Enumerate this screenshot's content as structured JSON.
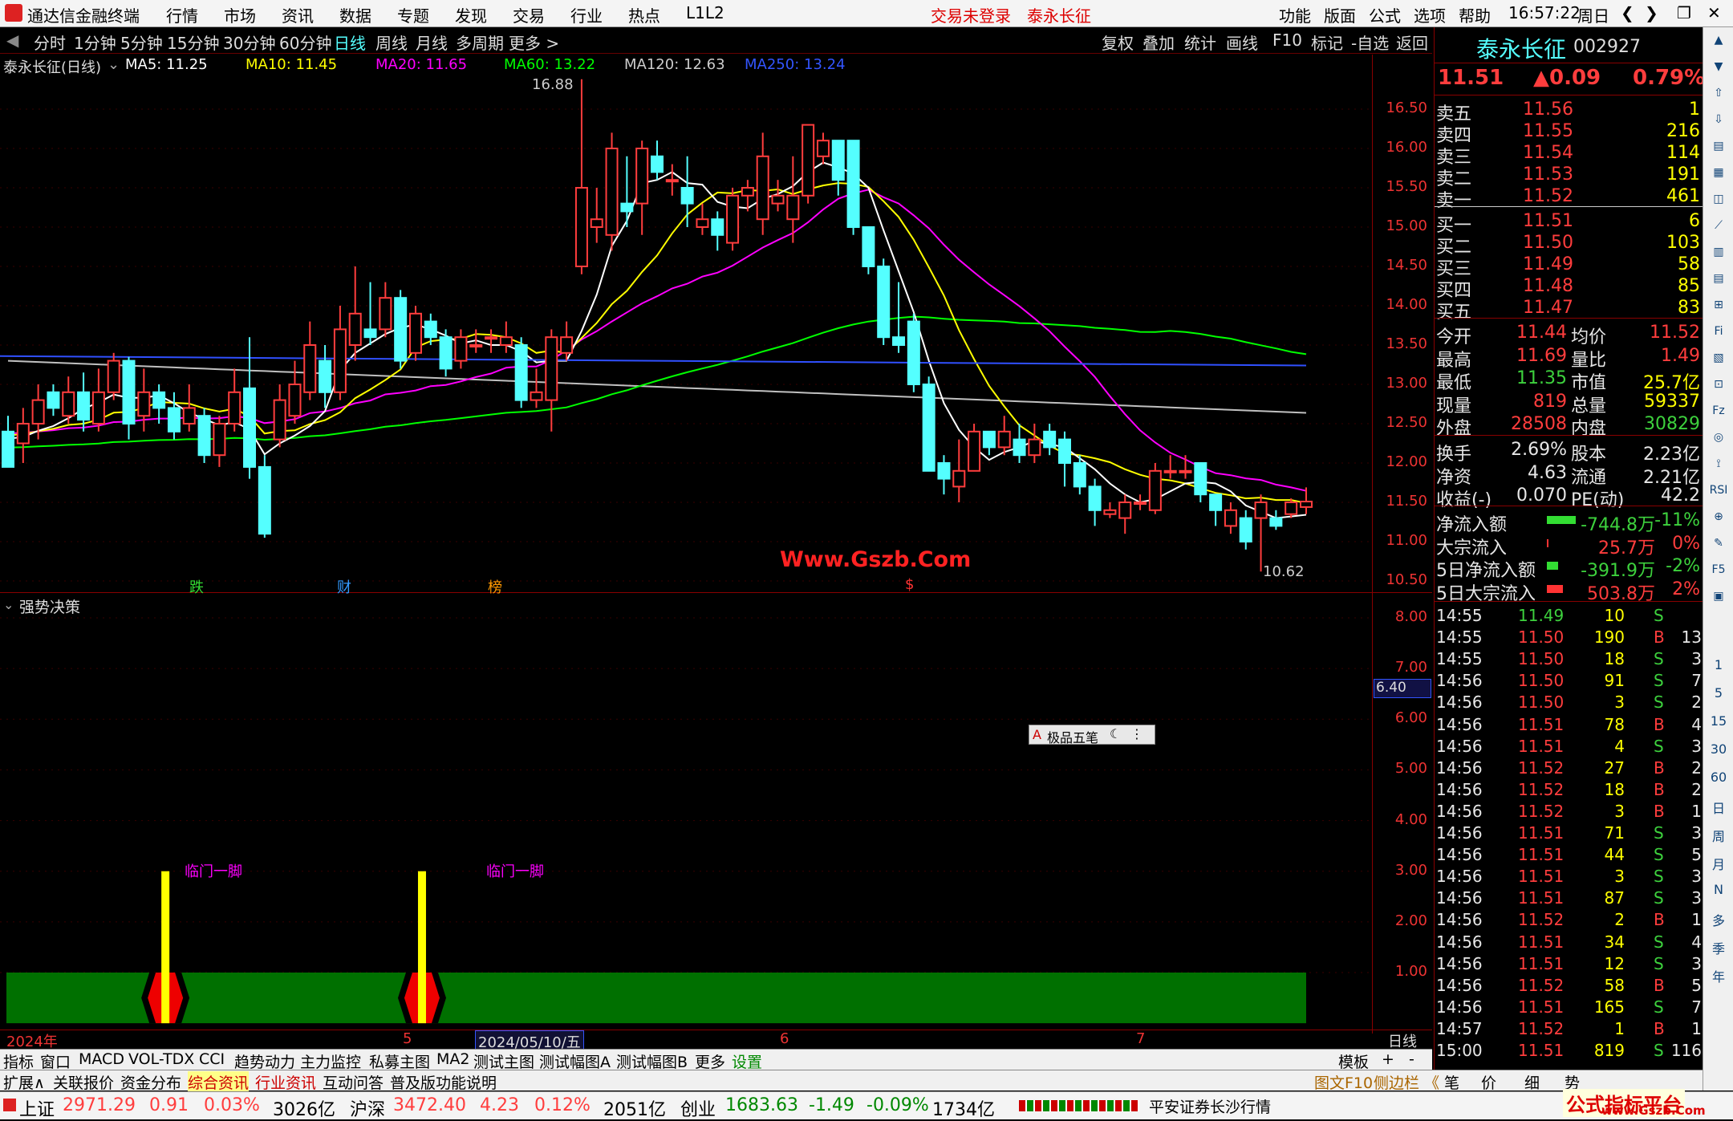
{
  "menubar": {
    "app_title": "通达信金融终端",
    "menus": [
      "行情",
      "市场",
      "资讯",
      "数据",
      "专题",
      "发现",
      "交易",
      "行业",
      "热点",
      "L1L2"
    ],
    "trade_status": "交易未登录",
    "stock_name": "泰永长征",
    "right_menus": [
      "功能",
      "版面",
      "公式",
      "选项",
      "帮助"
    ],
    "time": "16:57:22",
    "weekday": "周日"
  },
  "toolbar": {
    "periods": [
      "分时",
      "1分钟",
      "5分钟",
      "15分钟",
      "30分钟",
      "60分钟",
      "日线",
      "周线",
      "月线",
      "多周期",
      "更多 >"
    ],
    "active": "日线",
    "right": [
      "复权",
      "叠加",
      "统计",
      "画线",
      "F10",
      "标记",
      "-自选",
      "返回"
    ]
  },
  "chart_header": {
    "title": "泰永长征(日线)",
    "ma5": "MA5: 11.25",
    "ma10": "MA10: 11.45",
    "ma20": "MA20: 11.65",
    "ma60": "MA60: 13.22",
    "ma120": "MA120: 12.63",
    "ma250": "MA250: 13.24"
  },
  "colors": {
    "up": "#ff3d3d",
    "down": "#54ffff",
    "ma5": "#ffffff",
    "ma10": "#ffff00",
    "ma20": "#ff00ff",
    "ma60": "#00ff00",
    "ma120": "#c0c0c0",
    "ma250": "#3050ff"
  },
  "price_axis": [
    "16.50",
    "16.00",
    "15.50",
    "15.00",
    "14.50",
    "14.00",
    "13.50",
    "13.00",
    "12.50",
    "12.00",
    "11.50",
    "11.00",
    "10.50"
  ],
  "annotations": {
    "high": "16.88",
    "low": "10.62",
    "watermark": "Www.Gszb.Com",
    "marks": [
      "跌",
      "财",
      "榜",
      "$"
    ]
  },
  "indicator": {
    "title": "强势决策",
    "axis": [
      "8.00",
      "7.00",
      "6.00",
      "5.00",
      "4.00",
      "3.00",
      "2.00",
      "1.00"
    ],
    "current": "6.40",
    "signal_label": "临门一脚",
    "toolbox_label": "极品五笔",
    "toolbox_icon": "A"
  },
  "date_axis": {
    "start": "2024年",
    "m5": "5",
    "cursor": "2024/05/10/五",
    "m6": "6",
    "m7": "7",
    "period": "日线"
  },
  "quote": {
    "name": "泰永长征",
    "code": "002927",
    "price": "11.51",
    "change": "▲0.09",
    "pct": "0.79%",
    "asks": [
      {
        "label": "卖五",
        "price": "11.56",
        "vol": "1"
      },
      {
        "label": "卖四",
        "price": "11.55",
        "vol": "216"
      },
      {
        "label": "卖三",
        "price": "11.54",
        "vol": "114"
      },
      {
        "label": "卖二",
        "price": "11.53",
        "vol": "191"
      },
      {
        "label": "卖一",
        "price": "11.52",
        "vol": "461"
      }
    ],
    "bids": [
      {
        "label": "买一",
        "price": "11.51",
        "vol": "6"
      },
      {
        "label": "买二",
        "price": "11.50",
        "vol": "103"
      },
      {
        "label": "买三",
        "price": "11.49",
        "vol": "58"
      },
      {
        "label": "买四",
        "price": "11.48",
        "vol": "85"
      },
      {
        "label": "买五",
        "price": "11.47",
        "vol": "83"
      }
    ],
    "stats": [
      [
        "今开",
        "11.44",
        "均价",
        "11.52"
      ],
      [
        "最高",
        "11.69",
        "量比",
        "1.49"
      ],
      [
        "最低",
        "11.35",
        "市值",
        "25.7亿"
      ],
      [
        "现量",
        "819",
        "总量",
        "59337"
      ],
      [
        "外盘",
        "28508",
        "内盘",
        "30829"
      ]
    ],
    "stats2": [
      [
        "换手",
        "2.69%",
        "股本",
        "2.23亿"
      ],
      [
        "净资",
        "4.63",
        "流通",
        "2.21亿"
      ],
      [
        "收益(-)",
        "0.070",
        "PE(动)",
        "42.2"
      ]
    ],
    "flows": [
      [
        "净流入额",
        "-744.8万",
        "-11%"
      ],
      [
        "大宗流入",
        "25.7万",
        "0%"
      ],
      [
        "5日净流入额",
        "-391.9万",
        "-2%"
      ],
      [
        "5日大宗流入",
        "503.8万",
        "2%"
      ]
    ],
    "ticks": [
      [
        "14:55",
        "11.49",
        "10",
        "S",
        ""
      ],
      [
        "14:55",
        "11.50",
        "190",
        "B",
        "13"
      ],
      [
        "14:55",
        "11.50",
        "18",
        "S",
        "3"
      ],
      [
        "14:56",
        "11.50",
        "91",
        "S",
        "7"
      ],
      [
        "14:56",
        "11.50",
        "3",
        "S",
        "2"
      ],
      [
        "14:56",
        "11.51",
        "78",
        "B",
        "4"
      ],
      [
        "14:56",
        "11.51",
        "4",
        "S",
        "3"
      ],
      [
        "14:56",
        "11.52",
        "27",
        "B",
        "2"
      ],
      [
        "14:56",
        "11.52",
        "18",
        "B",
        "2"
      ],
      [
        "14:56",
        "11.52",
        "3",
        "B",
        "1"
      ],
      [
        "14:56",
        "11.51",
        "71",
        "S",
        "3"
      ],
      [
        "14:56",
        "11.51",
        "44",
        "S",
        "5"
      ],
      [
        "14:56",
        "11.51",
        "3",
        "S",
        "3"
      ],
      [
        "14:56",
        "11.51",
        "87",
        "S",
        "3"
      ],
      [
        "14:56",
        "11.52",
        "2",
        "B",
        "1"
      ],
      [
        "14:56",
        "11.51",
        "34",
        "S",
        "4"
      ],
      [
        "14:56",
        "11.51",
        "12",
        "S",
        "3"
      ],
      [
        "14:56",
        "11.52",
        "58",
        "B",
        "5"
      ],
      [
        "14:56",
        "11.51",
        "165",
        "S",
        "7"
      ],
      [
        "14:57",
        "11.52",
        "1",
        "B",
        "1"
      ],
      [
        "15:00",
        "11.51",
        "819",
        "S",
        "116"
      ]
    ]
  },
  "rightbar": [
    "1",
    "5",
    "15",
    "30",
    "60",
    "日",
    "周",
    "月",
    "N",
    "多",
    "季",
    "年"
  ],
  "tabs1": [
    "指标",
    "窗口",
    "MACD",
    "VOL-TDX",
    "CCI",
    "趋势动力",
    "主力监控",
    "私募主图",
    "MA2",
    "测试主图",
    "测试幅图A",
    "测试幅图B",
    "更多",
    "设置",
    "模板",
    "+",
    "-"
  ],
  "tabs2": [
    "扩展∧",
    "关联报价",
    "资金分布",
    "综合资讯",
    "行业资讯",
    "互动问答",
    "普及版功能说明",
    "图文F10",
    "侧边栏 《",
    "笔",
    "价",
    "细",
    "势"
  ],
  "status": {
    "sh_label": "上证",
    "sh": "2971.29",
    "sh_chg": "0.91",
    "sh_pct": "0.03%",
    "sh_amt": "3026亿",
    "hs_label": "沪深",
    "hs": "3472.40",
    "hs_chg": "4.23",
    "hs_pct": "0.12%",
    "hs_amt": "2051亿",
    "cy_label": "创业",
    "cy": "1683.63",
    "cy_chg": "-1.49",
    "cy_pct": "-0.09%",
    "cy_amt": "1734亿",
    "broker": "平安证券长沙行情",
    "brand": "公式指标平台",
    "brand_url": "www.Gszb.Com"
  },
  "candles": [
    [
      12.4,
      11.95,
      12.6,
      11.95
    ],
    [
      12.25,
      12.5,
      12.7,
      12.0
    ],
    [
      12.5,
      12.8,
      13.0,
      12.3
    ],
    [
      12.9,
      12.7,
      13.0,
      12.6
    ],
    [
      12.6,
      12.9,
      13.1,
      12.5
    ],
    [
      12.9,
      12.55,
      13.15,
      12.4
    ],
    [
      12.5,
      12.9,
      13.2,
      12.4
    ],
    [
      12.9,
      13.3,
      13.4,
      12.8
    ],
    [
      13.3,
      12.5,
      13.35,
      12.3
    ],
    [
      12.6,
      12.9,
      13.2,
      12.4
    ],
    [
      12.9,
      12.7,
      13.0,
      12.5
    ],
    [
      12.7,
      12.4,
      12.9,
      12.3
    ],
    [
      12.5,
      12.7,
      13.0,
      12.4
    ],
    [
      12.6,
      12.1,
      12.7,
      12.0
    ],
    [
      12.1,
      12.5,
      12.6,
      11.95
    ],
    [
      12.5,
      12.9,
      13.2,
      12.4
    ],
    [
      12.95,
      11.95,
      13.6,
      11.8
    ],
    [
      11.95,
      11.1,
      12.1,
      11.05
    ],
    [
      12.3,
      12.8,
      13.0,
      12.2
    ],
    [
      12.6,
      13.0,
      13.3,
      12.5
    ],
    [
      12.9,
      13.5,
      13.8,
      12.8
    ],
    [
      13.3,
      12.9,
      13.5,
      12.7
    ],
    [
      12.9,
      13.7,
      14.0,
      12.8
    ],
    [
      13.5,
      13.9,
      14.5,
      13.3
    ],
    [
      13.7,
      13.6,
      14.3,
      13.5
    ],
    [
      13.7,
      14.1,
      14.3,
      13.6
    ],
    [
      14.1,
      13.3,
      14.2,
      13.2
    ],
    [
      13.4,
      13.9,
      14.0,
      13.3
    ],
    [
      13.8,
      13.6,
      13.9,
      13.5
    ],
    [
      13.6,
      13.2,
      13.7,
      13.1
    ],
    [
      13.3,
      13.6,
      13.7,
      13.2
    ],
    [
      13.5,
      13.5,
      13.7,
      13.4
    ],
    [
      13.6,
      13.6,
      13.7,
      13.4
    ],
    [
      13.5,
      13.6,
      13.8,
      13.4
    ],
    [
      13.5,
      12.8,
      13.6,
      12.7
    ],
    [
      12.8,
      12.9,
      13.2,
      12.7
    ],
    [
      12.8,
      13.6,
      13.7,
      12.4
    ],
    [
      13.4,
      13.6,
      13.8,
      13.3
    ],
    [
      14.5,
      15.5,
      16.88,
      14.4
    ],
    [
      15.0,
      15.1,
      15.5,
      14.8
    ],
    [
      14.9,
      16.0,
      16.2,
      14.7
    ],
    [
      15.3,
      15.2,
      15.9,
      15.0
    ],
    [
      15.3,
      16.0,
      16.1,
      14.9
    ],
    [
      15.9,
      15.7,
      16.1,
      15.6
    ],
    [
      15.6,
      15.6,
      15.8,
      15.4
    ],
    [
      15.5,
      15.3,
      15.9,
      15.0
    ],
    [
      15.0,
      15.1,
      15.3,
      14.9
    ],
    [
      15.1,
      14.9,
      15.2,
      14.7
    ],
    [
      14.8,
      15.4,
      15.5,
      14.7
    ],
    [
      15.4,
      15.5,
      15.6,
      15.2
    ],
    [
      15.1,
      15.9,
      16.2,
      14.9
    ],
    [
      15.3,
      15.4,
      15.6,
      15.2
    ],
    [
      15.1,
      15.4,
      15.9,
      14.8
    ],
    [
      15.4,
      16.3,
      16.3,
      15.3
    ],
    [
      15.9,
      16.1,
      16.2,
      15.8
    ],
    [
      16.1,
      15.6,
      16.1,
      15.4
    ],
    [
      16.1,
      15.0,
      16.1,
      14.9
    ],
    [
      15.0,
      14.5,
      15.0,
      14.4
    ],
    [
      14.5,
      13.6,
      14.6,
      13.5
    ],
    [
      13.6,
      13.5,
      14.3,
      13.4
    ],
    [
      13.8,
      13.0,
      13.9,
      12.9
    ],
    [
      13.0,
      11.9,
      13.1,
      11.9
    ],
    [
      12.0,
      11.8,
      12.1,
      11.6
    ],
    [
      11.7,
      11.9,
      12.3,
      11.5
    ],
    [
      11.9,
      12.4,
      12.5,
      11.9
    ],
    [
      12.4,
      12.2,
      12.4,
      12.1
    ],
    [
      12.2,
      12.4,
      12.6,
      12.1
    ],
    [
      12.3,
      12.1,
      12.5,
      12.0
    ],
    [
      12.1,
      12.3,
      12.5,
      12.0
    ],
    [
      12.4,
      12.2,
      12.5,
      12.1
    ],
    [
      12.3,
      12.0,
      12.4,
      11.7
    ],
    [
      12.0,
      11.7,
      12.1,
      11.6
    ],
    [
      11.7,
      11.4,
      11.8,
      11.2
    ],
    [
      11.35,
      11.4,
      11.5,
      11.3
    ],
    [
      11.3,
      11.5,
      11.6,
      11.1
    ],
    [
      11.5,
      11.5,
      11.6,
      11.4
    ],
    [
      11.4,
      11.9,
      12.0,
      11.35
    ],
    [
      11.9,
      11.9,
      12.1,
      11.8
    ],
    [
      11.9,
      11.9,
      12.1,
      11.8
    ],
    [
      12.0,
      11.6,
      12.0,
      11.5
    ],
    [
      11.6,
      11.4,
      11.6,
      11.2
    ],
    [
      11.2,
      11.4,
      11.5,
      11.1
    ],
    [
      11.3,
      11.0,
      11.4,
      10.9
    ],
    [
      11.3,
      11.5,
      11.6,
      10.62
    ],
    [
      11.3,
      11.2,
      11.4,
      11.15
    ],
    [
      11.35,
      11.5,
      11.55,
      11.3
    ],
    [
      11.44,
      11.51,
      11.69,
      11.35
    ]
  ],
  "ma250_pts": [
    [
      0,
      13.36
    ],
    [
      1760,
      13.24
    ]
  ],
  "signal_idx": [
    10,
    27
  ]
}
